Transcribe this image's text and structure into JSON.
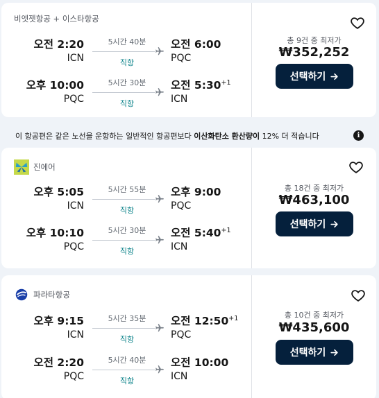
{
  "results": [
    {
      "airline": "비엣젯항공 + 이스타항공",
      "logo": null,
      "legs": [
        {
          "dep_time": "오전 2:20",
          "dep_code": "ICN",
          "duration": "5시간 40분",
          "stops": "직항",
          "arr_time": "오전 6:00",
          "arr_suffix": "",
          "arr_code": "PQC"
        },
        {
          "dep_time": "오후 10:00",
          "dep_code": "PQC",
          "duration": "5시간 30분",
          "stops": "직항",
          "arr_time": "오전 5:30",
          "arr_suffix": "+1",
          "arr_code": "ICN"
        }
      ],
      "price_info": "총 9건 중 최저가",
      "price": "₩352,252",
      "select_label": "선택하기"
    },
    {
      "airline": "진에어",
      "logo": "jinair-logo",
      "legs": [
        {
          "dep_time": "오후 5:05",
          "dep_code": "ICN",
          "duration": "5시간 55분",
          "stops": "직항",
          "arr_time": "오후 9:00",
          "arr_suffix": "",
          "arr_code": "PQC"
        },
        {
          "dep_time": "오후 10:10",
          "dep_code": "PQC",
          "duration": "5시간 30분",
          "stops": "직항",
          "arr_time": "오전 5:40",
          "arr_suffix": "+1",
          "arr_code": "ICN"
        }
      ],
      "price_info": "총 18건 중 최저가",
      "price": "₩463,100",
      "select_label": "선택하기"
    },
    {
      "airline": "파라타항공",
      "logo": "parata-logo",
      "legs": [
        {
          "dep_time": "오후 9:15",
          "dep_code": "ICN",
          "duration": "5시간 35분",
          "stops": "직항",
          "arr_time": "오전 12:50",
          "arr_suffix": "+1",
          "arr_code": "PQC"
        },
        {
          "dep_time": "오전 2:20",
          "dep_code": "PQC",
          "duration": "5시간 40분",
          "stops": "직항",
          "arr_time": "오전 10:00",
          "arr_suffix": "",
          "arr_code": "ICN"
        }
      ],
      "price_info": "총 10건 중 최저가",
      "price": "₩435,600",
      "select_label": "선택하기"
    }
  ],
  "eco_banner": {
    "text_before": "이 항공편은 같은 노선을 운항하는 일반적인 항공편보다 ",
    "highlight": "이산화탄소 환산량이",
    "text_after": " 12% 더 적습니다",
    "info_icon": "info-icon"
  },
  "colors": {
    "page_bg": "#eff3f8",
    "button_bg": "#05203c",
    "stops_text": "#0c838a"
  },
  "icons": {
    "favorite": "heart-outline-icon",
    "plane": "plane-icon",
    "arrow": "arrow-right-icon"
  }
}
